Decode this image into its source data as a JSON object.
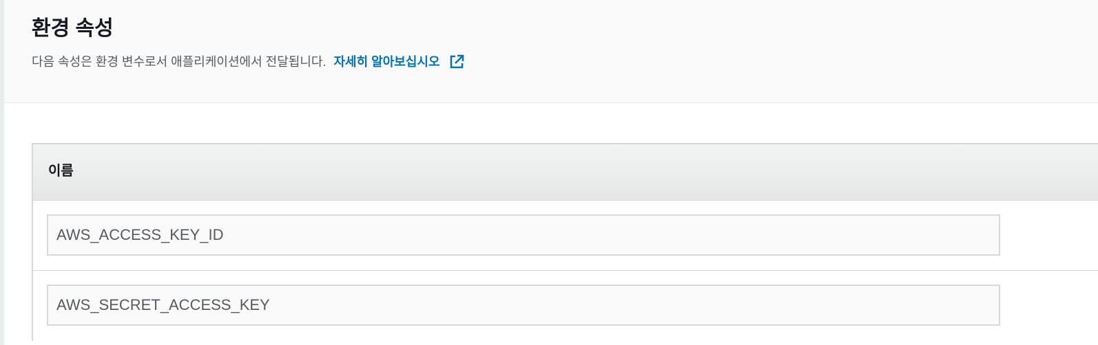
{
  "section": {
    "title": "환경 속성",
    "description": "다음 속성은 환경 변수로서 애플리케이션에서 전달됩니다.",
    "learn_more": "자세히 알아보십시오",
    "learn_more_icon": "external-link-icon"
  },
  "table": {
    "columns": [
      "이름"
    ],
    "rows": [
      {
        "name": "AWS_ACCESS_KEY_ID"
      },
      {
        "name": "AWS_SECRET_ACCESS_KEY"
      }
    ]
  },
  "colors": {
    "link": "#0073bb",
    "header_bg": "#fafafa",
    "border": "#d5dbdb"
  }
}
